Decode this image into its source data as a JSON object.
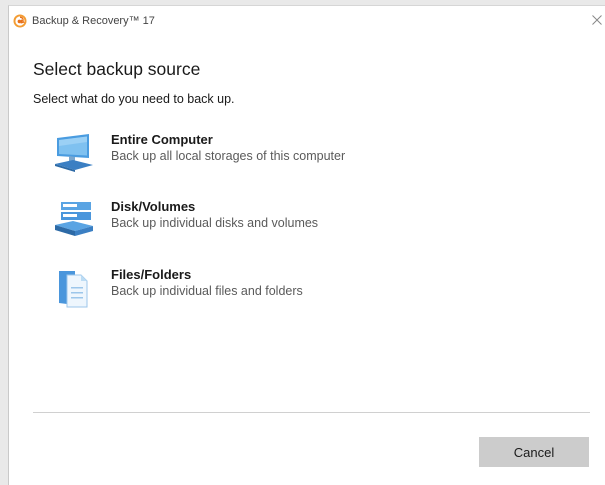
{
  "window": {
    "title": "Backup & Recovery™ 17",
    "app_icon": "backup-recovery-logo",
    "close_icon": "close-icon"
  },
  "page": {
    "title": "Select backup source",
    "subtitle": "Select what do you need to back up."
  },
  "options": [
    {
      "title": "Entire Computer",
      "description": "Back up all local storages of this computer",
      "icon": "computer-icon"
    },
    {
      "title": "Disk/Volumes",
      "description": "Back up individual disks and volumes",
      "icon": "disk-volumes-icon"
    },
    {
      "title": "Files/Folders",
      "description": "Back up individual files and folders",
      "icon": "files-folders-icon"
    }
  ],
  "footer": {
    "cancel_label": "Cancel"
  },
  "colors": {
    "accent_orange": "#e8711a",
    "icon_blue": "#3f8fd8",
    "button_gray": "#cccccc"
  }
}
